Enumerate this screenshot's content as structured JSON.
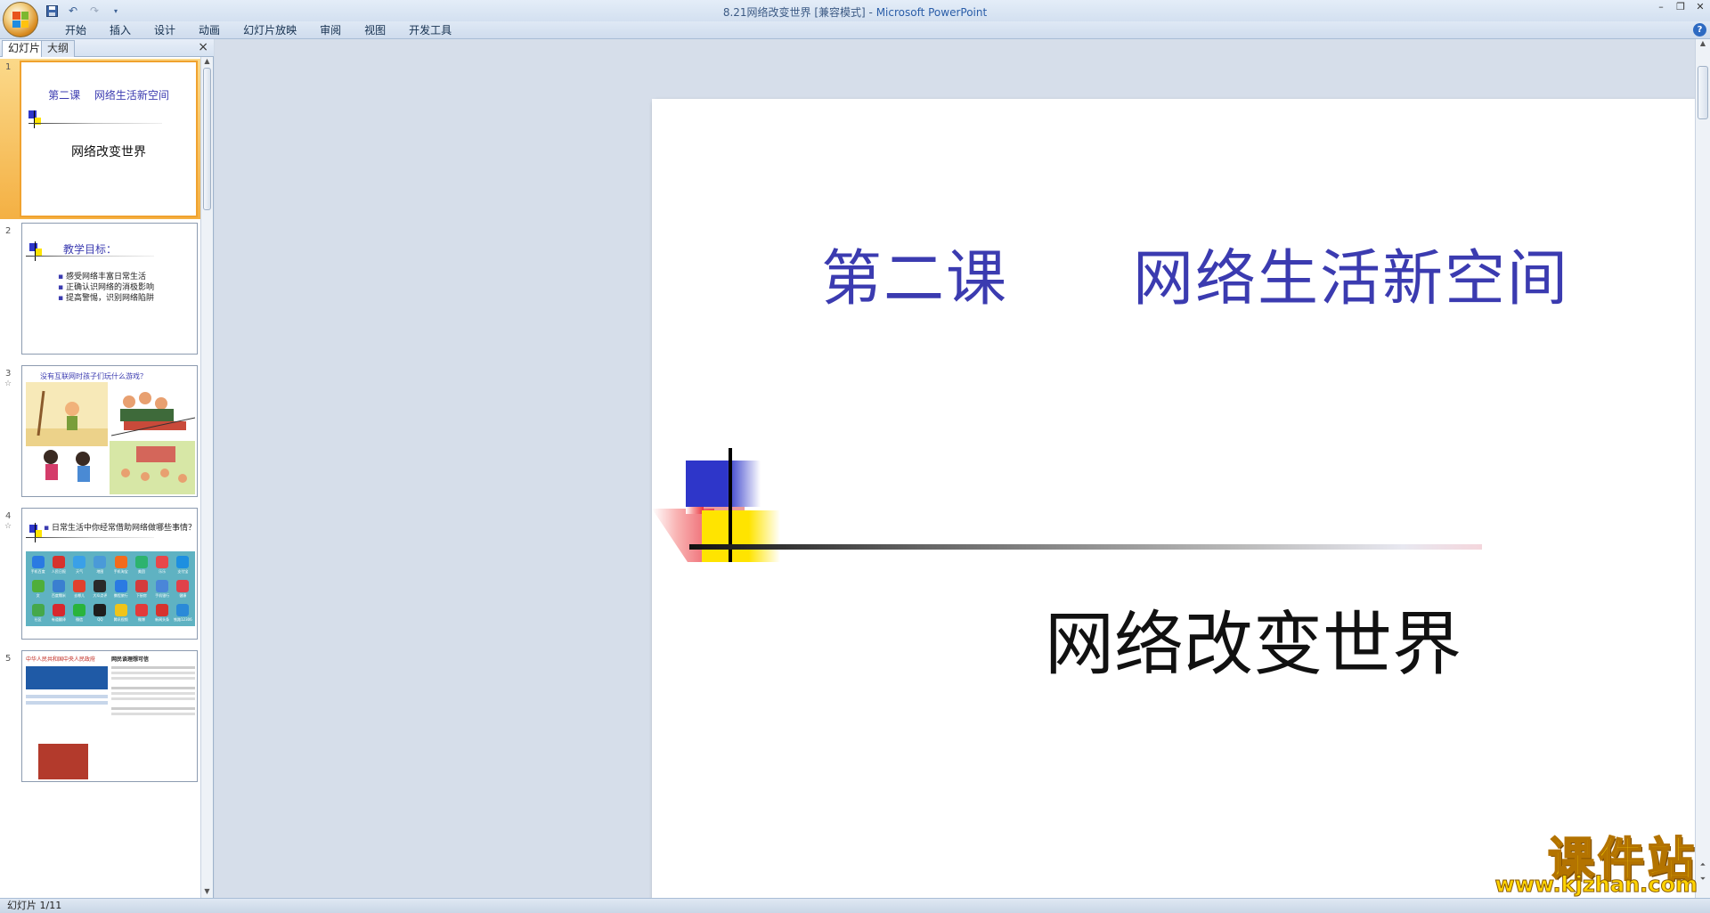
{
  "window": {
    "title": "8.21网络改变世界 [兼容模式]",
    "app_name": "Microsoft PowerPoint",
    "title_separator": " - "
  },
  "ribbon": {
    "tabs": [
      "开始",
      "插入",
      "设计",
      "动画",
      "幻灯片放映",
      "审阅",
      "视图",
      "开发工具"
    ],
    "help": "?"
  },
  "pane": {
    "tab_slides": "幻灯片",
    "tab_outline": "大纲",
    "close": "×"
  },
  "thumbnails": [
    {
      "num": "1",
      "title_line": "第二课　 网络生活新空间",
      "subtitle": "网络改变世界"
    },
    {
      "num": "2",
      "heading": "教学目标：",
      "bullets": [
        "感受网络丰富日常生活",
        "正确认识网络的消极影响",
        "提高警惕，识别网络陷阱"
      ]
    },
    {
      "num": "3",
      "heading": "没有互联网时孩子们玩什么游戏？"
    },
    {
      "num": "4",
      "heading": "日常生活中你经常借助网络做哪些事情？",
      "apps": [
        "手机百度",
        "人民日报",
        "天气",
        "地图",
        "手机淘宝",
        "美团",
        "乐乐",
        "支付宝",
        "文",
        "百度糯米",
        "去哪儿",
        "大众点评",
        "携程旅行",
        "下厨房",
        "手机银行",
        "健康",
        "社区",
        "有道翻译",
        "微信",
        "QQ",
        "腾讯视频",
        "微博",
        "新闻头条",
        "铁路12306"
      ]
    },
    {
      "num": "5",
      "heading": "中华人民共和国中央人民政府",
      "side_heading": "网民谈理想可信"
    }
  ],
  "slide": {
    "title": "第二课　　网络生活新空间",
    "subtitle": "网络改变世界"
  },
  "statusbar": {
    "slide_info": "幻灯片 1/11"
  },
  "watermark": {
    "text": "课件站",
    "url": "www.kjzhan.com"
  },
  "colors": {
    "title_blue": "#3b3bb0",
    "deco_blue": "#2e36c9",
    "deco_yellow": "#ffe400",
    "selected_orange": "#f4b043"
  }
}
